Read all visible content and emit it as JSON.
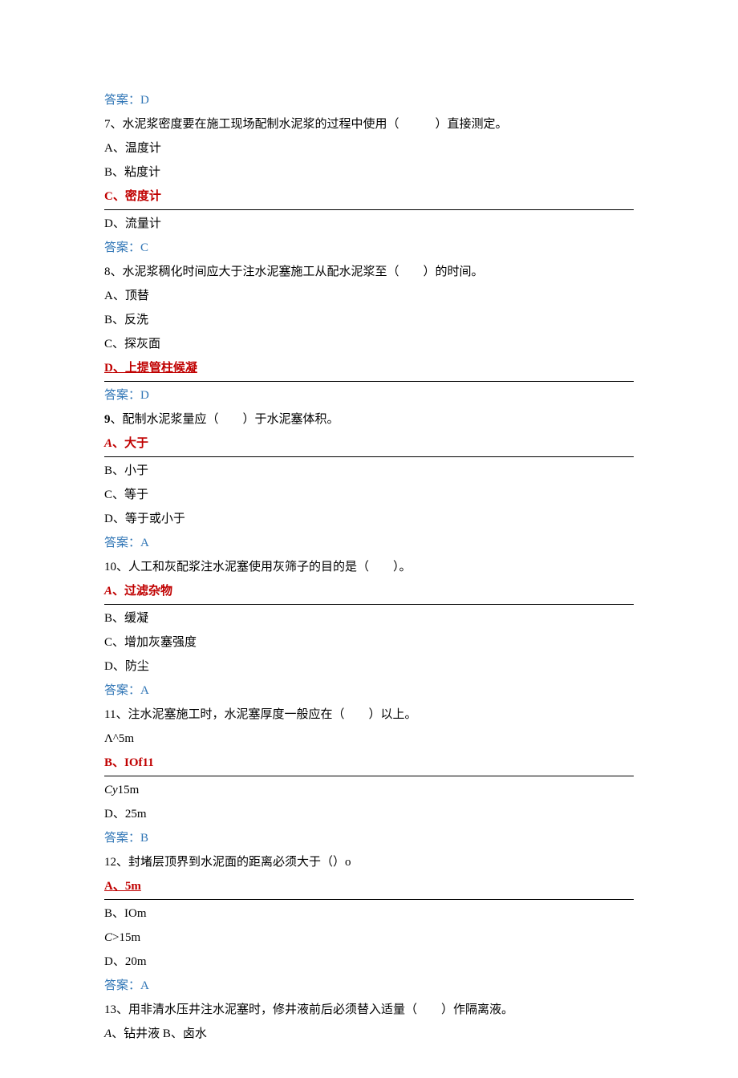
{
  "lines": {
    "ans_d": "答案：D",
    "q7": "7、水泥浆密度要在施工现场配制水泥浆的过程中使用（　　　）直接测定。",
    "q7_a": "A、温度计",
    "q7_b": "B、粘度计",
    "q7_c_prefix": "C",
    "q7_c_rest": "、密度计",
    "q7_d": "D、流量计",
    "ans_c": "答案：C",
    "q8": "8、水泥浆稠化时间应大于注水泥塞施工从配水泥浆至（　　）的时间。",
    "q8_a": "A、顶替",
    "q8_b": "B、反洗",
    "q8_c": "C、探灰面",
    "q8_d_prefix": "D",
    "q8_d_rest": "、上提管柱候凝",
    "ans_d2": "答案：D",
    "q9_num": "9",
    "q9_rest": "、配制水泥浆量应（　　）于水泥塞体积。",
    "q9_a_prefix": "A",
    "q9_a_rest": "、大于",
    "q9_b": "B、小于",
    "q9_c": "C、等于",
    "q9_d": "D、等于或小于",
    "ans_a": "答案：A",
    "q10": "10、人工和灰配浆注水泥塞使用灰筛子的目的是（　　）。",
    "q10_a_prefix": "A",
    "q10_a_rest": "、过滤杂物",
    "q10_b": "B、缓凝",
    "q10_c": "C、增加灰塞强度",
    "q10_d": "D、防尘",
    "ans_a2": "答案：A",
    "q11": "11、注水泥塞施工时，水泥塞厚度一般应在（　　）以上。",
    "q11_a": "Λ^5m",
    "q11_b_prefix": "B",
    "q11_b_rest": "、IOf11",
    "q11_c_prefix": "Cy",
    "q11_c_rest": "15m",
    "q11_d": "D、25m",
    "ans_b": "答案：B",
    "q12": "12、封堵层顶界到水泥面的距离必须大于（）o",
    "q12_a_prefix": "A",
    "q12_a_rest": "、5m",
    "q12_b": "B、IOm",
    "q12_c_prefix": "C",
    "q12_c_rest": ">15m",
    "q12_d": "D、20m",
    "ans_a3": "答案：A",
    "q13": "13、用非清水压井注水泥塞时，修井液前后必须替入适量（　　）作隔离液。",
    "q13_a_prefix": "A",
    "q13_a_rest": "、钻井液 B、卤水"
  }
}
